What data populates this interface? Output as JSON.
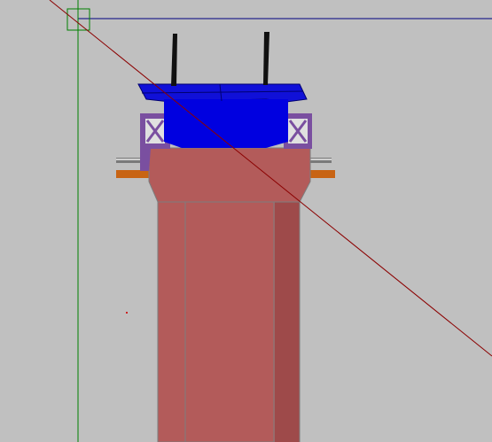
{
  "viewport": {
    "background_color": "#c0c0c0",
    "x_axis_color": "#000080",
    "y_axis_color": "#008000",
    "section_line_color": "#8b0000",
    "pick_box_color": "#008000"
  },
  "model": {
    "pier_color": "#b35b5a",
    "pier_shadow_color": "#9e4a4a",
    "pier_edge_color": "#7d7d7d",
    "girder_color": "#0000e0",
    "girder_top_color": "#1010d8",
    "bearing_color": "#7a4fa0",
    "bearing_inner_color": "#e0e0e0",
    "rail_color": "#7a7a7a",
    "rail_top_color": "#d0d0d0",
    "plate_color": "#c86414",
    "post_color": "#101010",
    "marker_color": "#cc2222"
  },
  "icons": {
    "pick_box": "pick-box-icon",
    "ucs": "ucs-crosshair-icon"
  }
}
